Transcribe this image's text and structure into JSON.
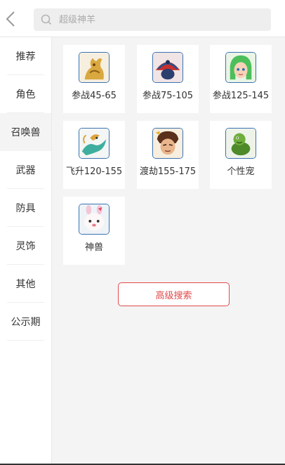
{
  "search": {
    "placeholder": "超级神羊"
  },
  "sidebar": {
    "items": [
      {
        "label": "推荐"
      },
      {
        "label": "角色"
      },
      {
        "label": "召唤兽"
      },
      {
        "label": "武器"
      },
      {
        "label": "防具"
      },
      {
        "label": "灵饰"
      },
      {
        "label": "其他"
      },
      {
        "label": "公示期"
      }
    ],
    "active": "召唤兽"
  },
  "grid": {
    "items": [
      {
        "label": "参战45-65",
        "icon": "golden-beast-icon"
      },
      {
        "label": "参战75-105",
        "icon": "peacock-icon"
      },
      {
        "label": "参战125-145",
        "icon": "green-hair-girl-icon"
      },
      {
        "label": "飞升120-155",
        "icon": "dragon-icon"
      },
      {
        "label": "渡劫155-175",
        "icon": "warrior-icon"
      },
      {
        "label": "个性宠",
        "icon": "green-turtle-icon"
      },
      {
        "label": "神兽",
        "icon": "bunny-icon"
      }
    ]
  },
  "main": {
    "advanced_search_label": "高级搜索"
  },
  "colors": {
    "accent": "#e24a4a",
    "panel": "#f4f4f4",
    "icon_border": "#3a72b0"
  }
}
